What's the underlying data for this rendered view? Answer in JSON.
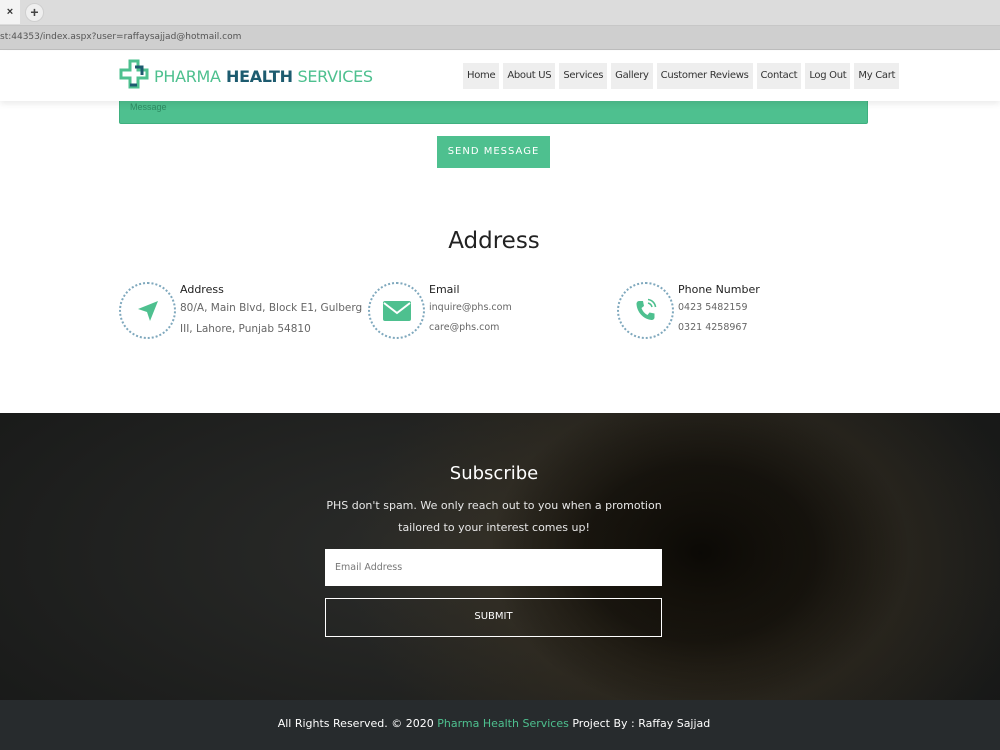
{
  "browser": {
    "tab_close": "×",
    "new_tab": "+",
    "url": "st:44353/index.aspx?user=raffaysajjad@hotmail.com"
  },
  "header": {
    "logo": {
      "part1": "PHARMA",
      "part2": " HEALTH",
      "part3": " SERVICES"
    },
    "nav": [
      {
        "label": "Home"
      },
      {
        "label": "About US"
      },
      {
        "label": "Services"
      },
      {
        "label": "Gallery"
      },
      {
        "label": "Customer Reviews"
      },
      {
        "label": "Contact"
      },
      {
        "label": "Log Out"
      },
      {
        "label": "My Cart"
      }
    ]
  },
  "contact_form": {
    "message_placeholder": "Message",
    "send_label": "SEND MESSAGE"
  },
  "address_section": {
    "title": "Address",
    "items": [
      {
        "icon": "location-arrow-icon",
        "heading": "Address",
        "lines": [
          "80/A, Main Blvd, Block E1, Gulberg",
          "III, Lahore, Punjab 54810"
        ]
      },
      {
        "icon": "envelope-icon",
        "heading": "Email",
        "lines": [
          "inquire@phs.com",
          "care@phs.com"
        ]
      },
      {
        "icon": "phone-icon",
        "heading": "Phone Number",
        "lines": [
          "0423 5482159",
          "0321 4258967"
        ]
      }
    ]
  },
  "subscribe": {
    "title": "Subscribe",
    "text_line1": "PHS don't spam. We only reach out to you when a promotion",
    "text_line2": "tailored to your interest comes up!",
    "email_placeholder": "Email Address",
    "submit_label": "SUBMIT"
  },
  "footer": {
    "prefix": "All Rights Reserved. © 2020 ",
    "brand": "Pharma Health Services",
    "suffix": " Project By : Raffay Sajjad"
  },
  "colors": {
    "accent": "#4ec08f",
    "logo_dark": "#1d5b6f",
    "footer_bg": "#272b2d"
  }
}
